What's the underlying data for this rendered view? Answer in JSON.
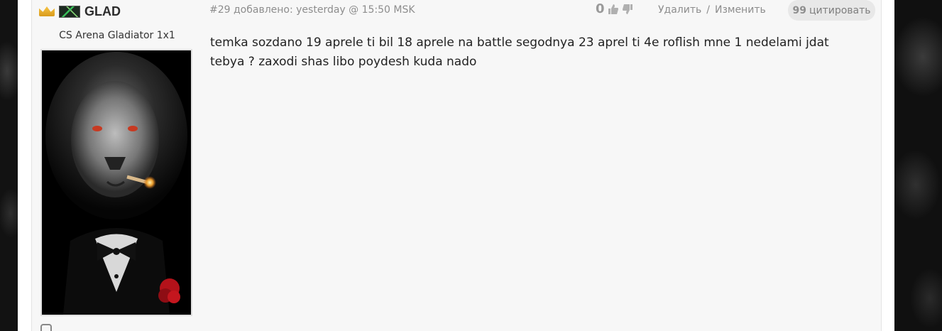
{
  "post": {
    "author": {
      "name": "GLAD",
      "title": "CS Arena Gladiator 1x1"
    },
    "meta": "#29 добавлено: yesterday @ 15:50 MSK",
    "rating": "0",
    "actions": {
      "delete": "Удалить",
      "separator": "/",
      "edit": "Изменить"
    },
    "quote_label": "цитировать",
    "quote_mark": "99",
    "message": "temka sozdano 19 aprele ti bil 18 aprele na battle segodnya 23 aprel ti 4e roflish mne 1 nedelami jdat tebya ? zaxodi shas libo poydesh kuda nado"
  },
  "icons": {
    "crown": "crown-icon",
    "rank": "rank-badge-icon",
    "like": "thumbs-up-icon",
    "dislike": "thumbs-down-icon",
    "quote": "quote-icon"
  },
  "colors": {
    "text": "#222222",
    "muted": "#8d8d8d",
    "post_background": "#f7f7f7",
    "crown": "#f6c445"
  }
}
